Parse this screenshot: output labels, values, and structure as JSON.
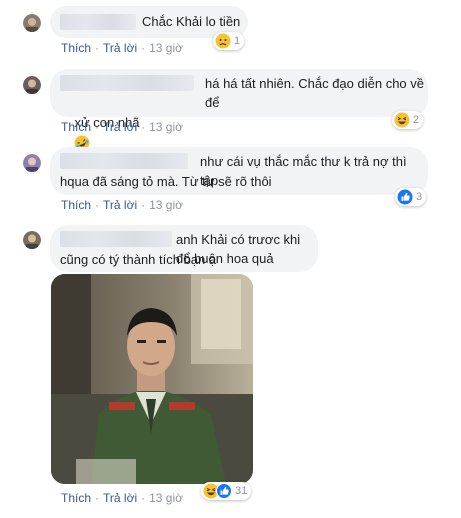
{
  "comments": [
    {
      "text": "Chắc Khải lo tiền",
      "actions": {
        "like": "Thích",
        "reply": "Trả lời",
        "time": "13 giờ"
      },
      "reaction": {
        "icon": "sad-face-icon",
        "count": "1"
      }
    },
    {
      "text_line1": "há há tất nhiên. Chắc đạo diễn cho về để",
      "text_line2": "xử con nhã",
      "inline_emojis": [
        "rofl-icon",
        "rofl-icon",
        "rofl-icon"
      ],
      "actions": {
        "like": "Thích",
        "reply": "Trả lời",
        "time": "13 giờ"
      },
      "reaction": {
        "icon": "haha-face-icon",
        "count": "2"
      }
    },
    {
      "text_line1": "như cái vụ thắc mắc thư k trả nợ thì tập",
      "text_line2": "hqua đã sáng tỏ mà. Từ từ sẽ rõ thôi",
      "actions": {
        "like": "Thích",
        "reply": "Trả lời",
        "time": "13 giờ"
      },
      "reaction": {
        "icon": "like-thumb-icon",
        "count": "3"
      }
    },
    {
      "text_line1": "anh Khải có trươc khi đổ buôn hoa quả",
      "text_line2": "cũng có tý thành tích bạn ạ",
      "actions": {
        "like": "Thích",
        "reply": "Trả lời",
        "time": "13 giờ"
      },
      "reaction": {
        "icons": [
          "haha-face-icon",
          "like-thumb-icon"
        ],
        "count": "31"
      }
    }
  ],
  "colors": {
    "link": "#385898",
    "meta": "#90949c",
    "bubble": "#f2f3f5",
    "like_blue": "#1877f2",
    "emoji_yellow": "#f7c132"
  }
}
